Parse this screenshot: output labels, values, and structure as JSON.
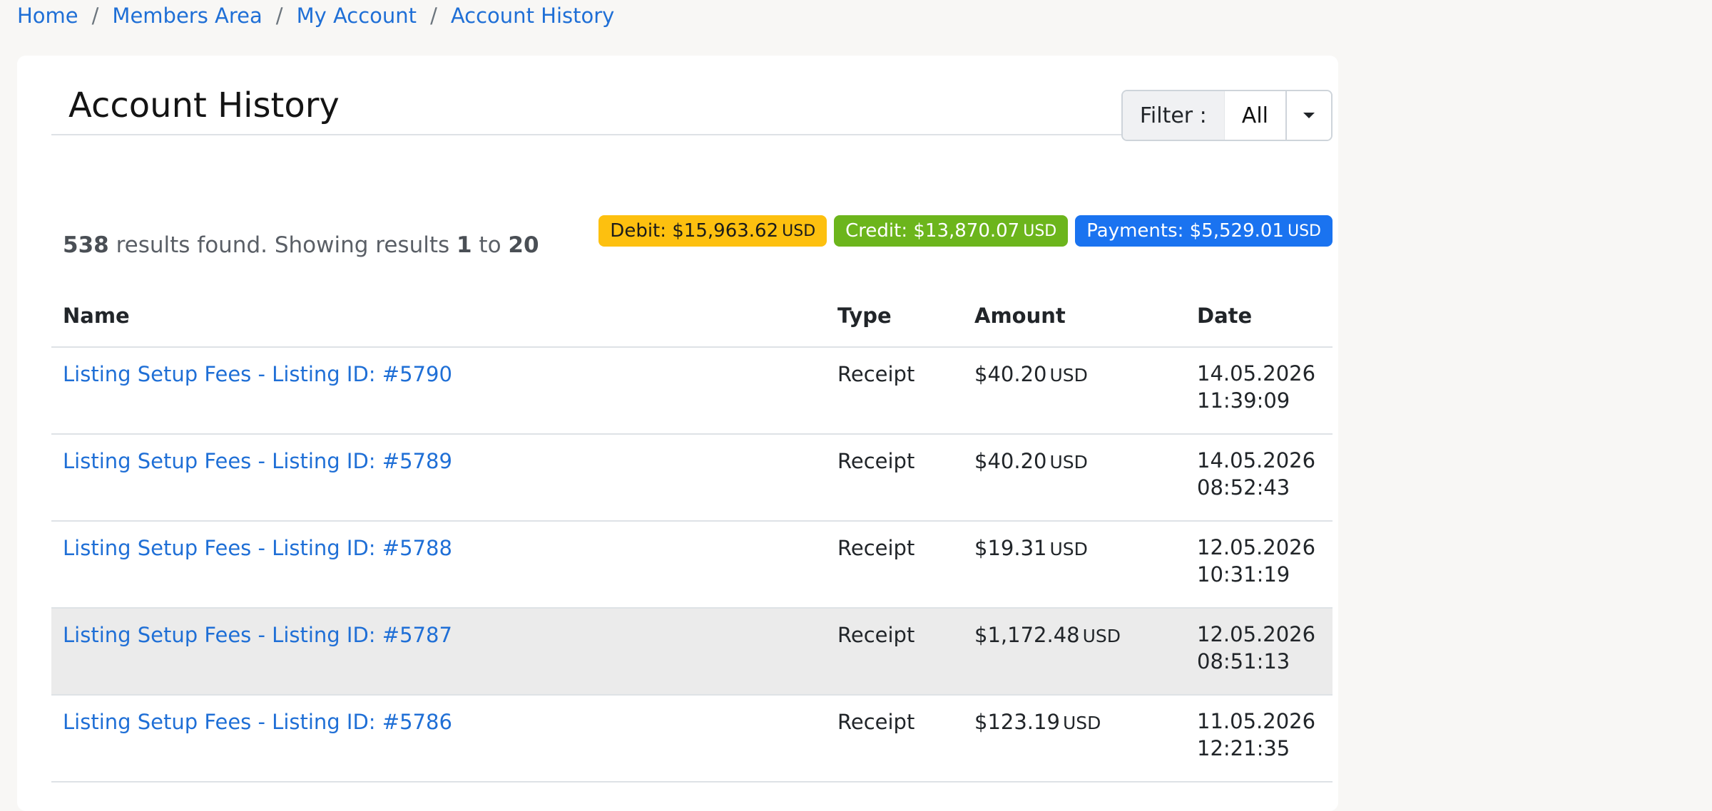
{
  "breadcrumb": [
    {
      "label": "Home"
    },
    {
      "label": "Members Area"
    },
    {
      "label": "My Account"
    },
    {
      "label": "Account History"
    }
  ],
  "page": {
    "title": "Account History",
    "filter_label": "Filter :",
    "filter_value": "All"
  },
  "totals": {
    "debit_label": "Debit: $15,963.62",
    "debit_currency": "USD",
    "credit_label": "Credit: $13,870.07",
    "credit_currency": "USD",
    "payments_label": "Payments: $5,529.01",
    "payments_currency": "USD",
    "colors": {
      "debit": "#fdc00f",
      "credit": "#6cb51c",
      "payments": "#1a73f0"
    }
  },
  "summary": {
    "total": "538",
    "text1": " results found. Showing results ",
    "from": "1",
    "text2": " to ",
    "to": "20"
  },
  "table": {
    "headers": [
      "Name",
      "Type",
      "Amount",
      "Date"
    ],
    "rows": [
      {
        "name": "Listing Setup Fees - Listing ID: #5790",
        "type": "Receipt",
        "amount": "$40.20",
        "currency": "USD",
        "date": "14.05.2026",
        "time": "11:39:09"
      },
      {
        "name": "Listing Setup Fees - Listing ID: #5789",
        "type": "Receipt",
        "amount": "$40.20",
        "currency": "USD",
        "date": "14.05.2026",
        "time": "08:52:43"
      },
      {
        "name": "Listing Setup Fees - Listing ID: #5788",
        "type": "Receipt",
        "amount": "$19.31",
        "currency": "USD",
        "date": "12.05.2026",
        "time": "10:31:19"
      },
      {
        "name": "Listing Setup Fees - Listing ID: #5787",
        "type": "Receipt",
        "amount": "$1,172.48",
        "currency": "USD",
        "date": "12.05.2026",
        "time": "08:51:13"
      },
      {
        "name": "Listing Setup Fees - Listing ID: #5786",
        "type": "Receipt",
        "amount": "$123.19",
        "currency": "USD",
        "date": "11.05.2026",
        "time": "12:21:35"
      }
    ]
  },
  "colors": {
    "link": "#1f6fd6",
    "row_hover": "#ebebeb"
  }
}
